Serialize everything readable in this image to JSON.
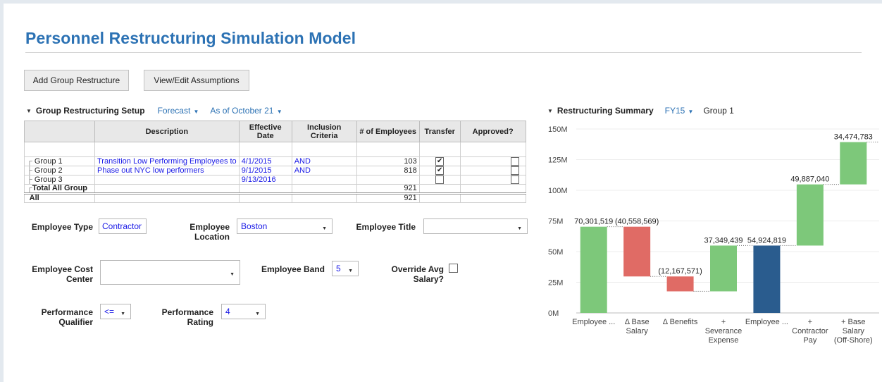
{
  "page": {
    "title": "Personnel Restructuring Simulation Model"
  },
  "toolbar": {
    "add_group_label": "Add Group Restructure",
    "view_assumptions_label": "View/Edit Assumptions"
  },
  "setup": {
    "title": "Group Restructuring Setup",
    "forecast_label": "Forecast",
    "as_of_label": "As of October 21",
    "columns": [
      "Description",
      "Effective Date",
      "Inclusion Criteria",
      "# of Employees",
      "Transfer",
      "Approved?"
    ],
    "rows": [
      {
        "name": "Group 1",
        "description": "Transition Low Performing Employees to",
        "date": "4/1/2015",
        "criteria": "AND",
        "employees": "103",
        "transfer": true,
        "approved": false
      },
      {
        "name": "Group 2",
        "description": "Phase out NYC low performers",
        "date": "9/1/2015",
        "criteria": "AND",
        "employees": "818",
        "transfer": true,
        "approved": false
      },
      {
        "name": "Group 3",
        "description": "",
        "date": "9/13/2016",
        "criteria": "",
        "employees": "",
        "transfer": false,
        "approved": false
      }
    ],
    "total_row": {
      "name": "Total All Group",
      "employees": "921"
    },
    "all_row": {
      "name": "All",
      "employees": "921"
    }
  },
  "filters": {
    "employee_type": {
      "label": "Employee Type",
      "value": "Contractor"
    },
    "employee_location": {
      "label_1": "Employee",
      "label_2": "Location",
      "value": "Boston"
    },
    "employee_title": {
      "label": "Employee Title",
      "value": ""
    },
    "cost_center": {
      "label_1": "Employee Cost",
      "label_2": "Center",
      "value": ""
    },
    "employee_band": {
      "label": "Employee Band",
      "value": "5"
    },
    "override_salary": {
      "label_1": "Override Avg",
      "label_2": "Salary?",
      "checked": false
    },
    "perf_qualifier": {
      "label_1": "Performance",
      "label_2": "Qualifier",
      "value": "<="
    },
    "perf_rating": {
      "label_1": "Performance",
      "label_2": "Rating",
      "value": "4"
    }
  },
  "summary": {
    "title": "Restructuring Summary",
    "period": "FY15",
    "group": "Group 1"
  },
  "colors": {
    "accent": "#2c72b4",
    "up": "#7dc87a",
    "down": "#e06b65",
    "total": "#2a5c8e"
  },
  "chart_data": {
    "type": "waterfall",
    "ylim": [
      0,
      150000000
    ],
    "yticks": [
      "0M",
      "25M",
      "50M",
      "75M",
      "100M",
      "125M",
      "150M"
    ],
    "bars": [
      {
        "category": "Employee ...",
        "label_lines": [
          "Employee ..."
        ],
        "value": 70301519,
        "label": "70,301,519",
        "kind": "total"
      },
      {
        "category": "Δ Base Salary",
        "label_lines": [
          "Δ Base",
          "Salary"
        ],
        "value": -40558569,
        "label": "(40,558,569)",
        "kind": "down"
      },
      {
        "category": "Δ Benefits",
        "label_lines": [
          "Δ Benefits"
        ],
        "value": -12167571,
        "label": "(12,167,571)",
        "kind": "down"
      },
      {
        "category": "+ Severance Expense",
        "label_lines": [
          "+",
          "Severance",
          "Expense"
        ],
        "value": 37349439,
        "label": "37,349,439",
        "kind": "up"
      },
      {
        "category": "Employee ...",
        "label_lines": [
          "Employee ..."
        ],
        "value": 54924819,
        "label": "54,924,819",
        "kind": "subtotal"
      },
      {
        "category": "+ Contractor Pay",
        "label_lines": [
          "+",
          "Contractor",
          "Pay"
        ],
        "value": 49887040,
        "label": "49,887,040",
        "kind": "up"
      },
      {
        "category": "+ Base Salary (Off-Shore)",
        "label_lines": [
          "+ Base",
          "Salary",
          "(Off-Shore)"
        ],
        "value": 34474783,
        "label": "34,474,783",
        "kind": "up"
      }
    ]
  }
}
